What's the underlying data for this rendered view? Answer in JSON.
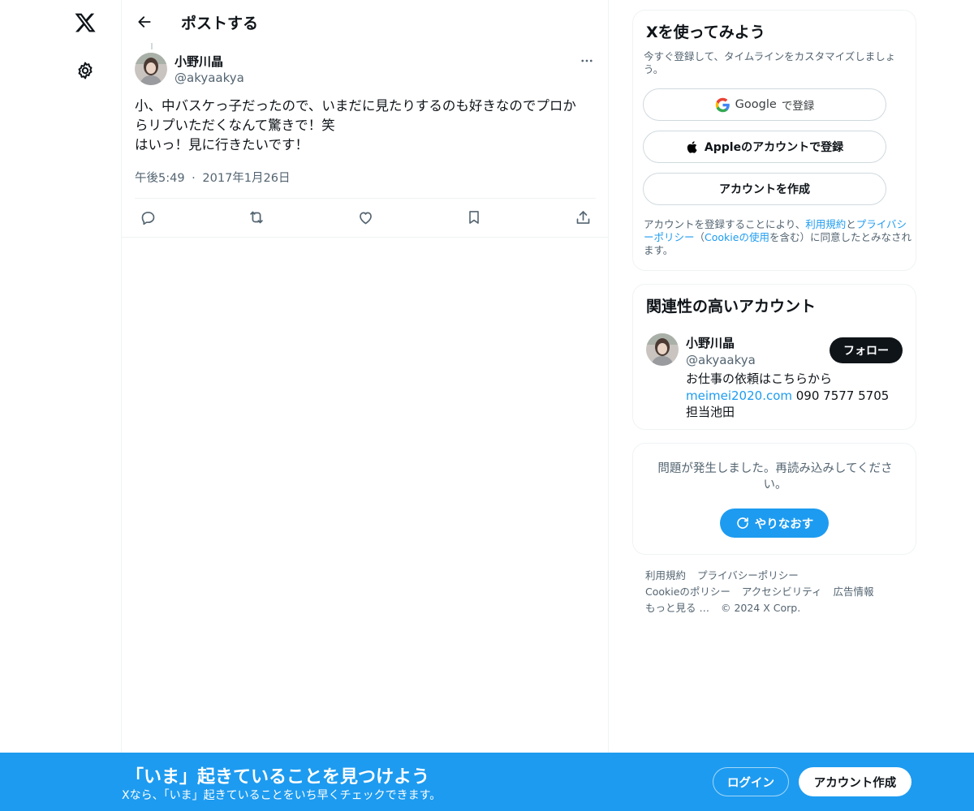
{
  "nav": {
    "logo_icon": "x-logo-icon",
    "settings_icon": "gear-icon"
  },
  "header": {
    "back_icon": "arrow-left-icon",
    "title": "ポストする"
  },
  "post": {
    "author_name": "小野川晶",
    "author_handle": "@akyaakya",
    "more_icon": "more-dots-icon",
    "text_lines": [
      "小、中バスケっ子だったので、いまだに見たりするのも好きなのでプロか",
      "らリプいただくなんて驚きで！笑",
      "はいっ！見に行きたいです！"
    ],
    "time": "午後5:49",
    "separator": "·",
    "date": "2017年1月26日",
    "actions": [
      "reply-icon",
      "repost-icon",
      "like-icon",
      "bookmark-icon",
      "share-icon"
    ]
  },
  "signup_card": {
    "title": "Xを使ってみよう",
    "description": "今すぐ登録して、タイムラインをカスタマイズしましょう。",
    "google_brand": "Google",
    "google_suffix": "で登録",
    "apple_label": "Appleのアカウントで登録",
    "create_label": "アカウントを作成",
    "legal_prefix": "アカウントを登録することにより、",
    "legal_terms": "利用規約",
    "legal_and": "と",
    "legal_privacy": "プライバシーポリシー",
    "legal_open": "（",
    "legal_cookie": "Cookieの使用",
    "legal_suffix": "を含む）に同意したとみなされます。"
  },
  "related_card": {
    "title": "関連性の高いアカウント",
    "name": "小野川晶",
    "handle": "@akyaakya",
    "follow_label": "フォロー",
    "bio_line1": "お仕事の依頼はこちらから",
    "bio_link": "meimei2020.com",
    "bio_rest": " 090 7577 5705 担当池田"
  },
  "error_card": {
    "message": "問題が発生しました。再読み込みしてください。",
    "retry_label": "やりなおす",
    "retry_icon": "refresh-icon"
  },
  "footer": {
    "links": [
      "利用規約",
      "プライバシーポリシー",
      "Cookieのポリシー",
      "アクセシビリティ",
      "広告情報",
      "もっと見る …"
    ],
    "copyright": "© 2024 X Corp."
  },
  "bottom_bar": {
    "title": "「いま」起きていることを見つけよう",
    "subtitle": "Xなら、「いま」起きていることをいち早くチェックできます。",
    "login_label": "ログイン",
    "signup_label": "アカウント作成"
  },
  "colors": {
    "accent": "#1d9bf0",
    "text_primary": "#0f1419",
    "text_secondary": "#536471",
    "border": "#eff3f4"
  }
}
